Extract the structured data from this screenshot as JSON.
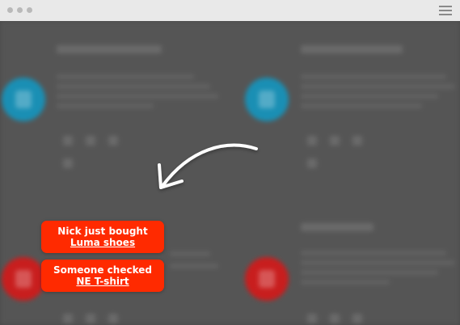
{
  "window": {
    "titlebar_color": "#e9e9e9",
    "icons": [
      "window-dot-icon",
      "window-dot-icon",
      "window-dot-icon",
      "hamburger-menu-icon"
    ]
  },
  "background": {
    "overlay_color": "#4a4a4a",
    "feature_icon_colors": [
      "#1a8fb4",
      "#1a8fb4",
      "#c81e1e",
      "#c81e1e"
    ]
  },
  "notifications": [
    {
      "line1": "Nick just bought",
      "link": "Luma shoes"
    },
    {
      "line1": "Someone checked",
      "link": "NE T-shirt"
    }
  ],
  "accent_color": "#ff2a00"
}
